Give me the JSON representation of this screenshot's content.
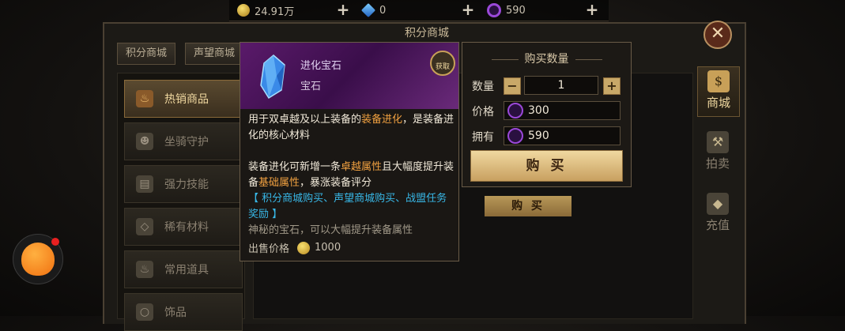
{
  "topbar": {
    "gold": "24.91万",
    "diamond": "0",
    "points": "590"
  },
  "shop": {
    "title": "积分商城",
    "tabs": [
      "积分商城",
      "声望商城"
    ],
    "sidebar": [
      "热销商品",
      "坐骑守护",
      "强力技能",
      "稀有材料",
      "常用道具",
      "饰品"
    ],
    "rightnav": [
      "商城",
      "拍卖",
      "充值"
    ],
    "bg_buy_label": "购 买"
  },
  "tooltip": {
    "name": "进化宝石",
    "type": "宝石",
    "get_label": "获取",
    "desc1_a": "用于双卓越及以上装备的",
    "desc1_hl": "装备进化",
    "desc1_b": "，是装备进化的核心材料",
    "desc2_a": "装备进化可新增一条",
    "desc2_hl1": "卓越属性",
    "desc2_b": "且大幅度提升装备",
    "desc2_hl2": "基础属性",
    "desc2_c": "，暴涨装备评分",
    "source": "【 积分商城购买、声望商城购买、战盟任务奖励 】",
    "flavor": "神秘的宝石，可以大幅提升装备属性",
    "sell_label": "出售价格",
    "sell_price": "1000"
  },
  "purchase": {
    "title": "购买数量",
    "qty_label": "数量",
    "qty": "1",
    "minus": "−",
    "plus": "+",
    "price_label": "价格",
    "price": "300",
    "own_label": "拥有",
    "own": "590",
    "buy_label": "购 买"
  },
  "icons": {
    "gold": "gold-coin",
    "diamond": "blue-crystal",
    "points": "purple-ring",
    "close": "close-x"
  },
  "colors": {
    "highlight": "#f0a040",
    "source": "#38b8e8",
    "tooltip_header": "#5a1a6a"
  }
}
